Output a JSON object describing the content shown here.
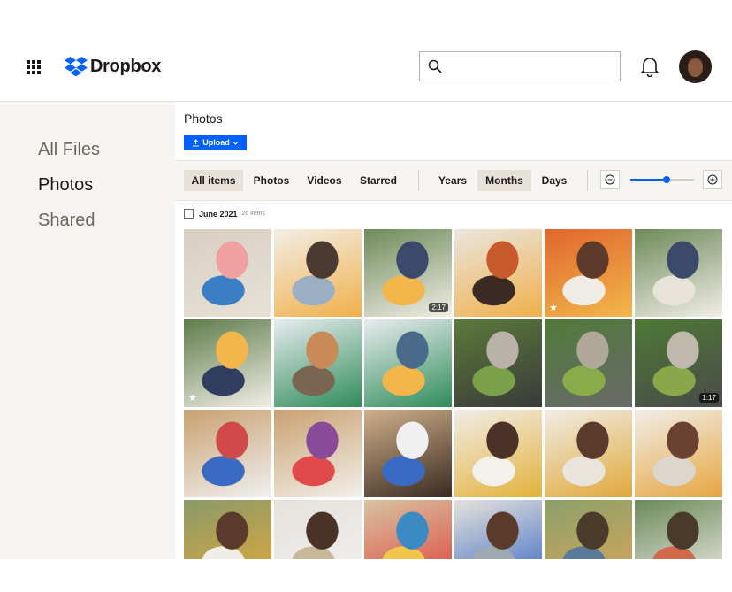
{
  "app": {
    "brand": "Dropbox"
  },
  "search": {
    "placeholder": ""
  },
  "sidebar": {
    "items": [
      {
        "label": "All Files"
      },
      {
        "label": "Photos"
      },
      {
        "label": "Shared"
      }
    ]
  },
  "main": {
    "title": "Photos",
    "upload_label": "Upload"
  },
  "filters": {
    "type_tabs": [
      "All items",
      "Photos",
      "Videos",
      "Starred"
    ],
    "time_tabs": [
      "Years",
      "Months",
      "Days"
    ],
    "selected_type": "All items",
    "selected_time": "Months"
  },
  "zoom": {
    "level": 0.57
  },
  "group": {
    "date": "June 2021",
    "count": "26 items"
  },
  "photos": [
    {
      "colors": [
        "#d7cfc2",
        "#e8e1d6",
        "#f0a0a0",
        "#3a7fc4"
      ],
      "duration": "",
      "starred": false
    },
    {
      "colors": [
        "#f2eee6",
        "#f0b04a",
        "#4a3a30",
        "#9aaec4"
      ],
      "duration": "",
      "starred": false
    },
    {
      "colors": [
        "#6e8a5a",
        "#f1eee6",
        "#3b4a6a",
        "#f2b64a"
      ],
      "duration": "2:17",
      "starred": false
    },
    {
      "colors": [
        "#e9e6df",
        "#f0b04a",
        "#c75a2c",
        "#3b2a24"
      ],
      "duration": "",
      "starred": false
    },
    {
      "colors": [
        "#e0662e",
        "#f2b74a",
        "#5d3a2a",
        "#f0ede6"
      ],
      "duration": "",
      "starred": true
    },
    {
      "colors": [
        "#6e8a5a",
        "#f1eee6",
        "#3b4a6a",
        "#e8e3d9"
      ],
      "duration": "",
      "starred": false
    },
    {
      "colors": [
        "#5e7c4a",
        "#f1eee6",
        "#f2b64a",
        "#2f3d5e"
      ],
      "duration": "",
      "starred": true
    },
    {
      "colors": [
        "#e7ecef",
        "#2f8c5a",
        "#c98a5a",
        "#7a6650"
      ],
      "duration": "",
      "starred": false
    },
    {
      "colors": [
        "#e9ecef",
        "#2f8c5a",
        "#4a6a8c",
        "#f2b64a"
      ],
      "duration": "",
      "starred": false
    },
    {
      "colors": [
        "#5b7a3a",
        "#3a3a3a",
        "#b9b2a8",
        "#7aa04a"
      ],
      "duration": "",
      "starred": false
    },
    {
      "colors": [
        "#4f7a3a",
        "#6a6a6a",
        "#b0a898",
        "#8aab4a"
      ],
      "duration": "",
      "starred": false
    },
    {
      "colors": [
        "#4d7a35",
        "#4a4a4a",
        "#c0b8aa",
        "#88a84a"
      ],
      "duration": "1:17",
      "starred": false
    },
    {
      "colors": [
        "#c9a170",
        "#f0f0f0",
        "#d04a4a",
        "#3a6ac4"
      ],
      "duration": "",
      "starred": false
    },
    {
      "colors": [
        "#c9a170",
        "#f2f0ea",
        "#8a4a9a",
        "#e04a4a"
      ],
      "duration": "",
      "starred": false
    },
    {
      "colors": [
        "#cfb08a",
        "#3a2a22",
        "#f0f0f0",
        "#3a6ac4"
      ],
      "duration": "",
      "starred": false
    },
    {
      "colors": [
        "#f0ede8",
        "#e3b23a",
        "#4a3226",
        "#f4f1ec"
      ],
      "duration": "",
      "starred": false
    },
    {
      "colors": [
        "#f0ede6",
        "#e1a83a",
        "#5a3a2a",
        "#e9e4dc"
      ],
      "duration": "",
      "starred": false
    },
    {
      "colors": [
        "#f1eee8",
        "#e6a640",
        "#6a4232",
        "#dcd6cc"
      ],
      "duration": "",
      "starred": false
    },
    {
      "colors": [
        "#8a9a6a",
        "#e1a93a",
        "#5a3a2a",
        "#f0ece6"
      ],
      "duration": "",
      "starred": false
    },
    {
      "colors": [
        "#e6e2dc",
        "#f0f0f0",
        "#4a3226",
        "#c9b79a"
      ],
      "duration": "",
      "starred": false
    },
    {
      "colors": [
        "#d7c3a2",
        "#e0443a",
        "#3a8ac4",
        "#f2c64a"
      ],
      "duration": "",
      "starred": false
    },
    {
      "colors": [
        "#e6e2dc",
        "#3a6ac4",
        "#5a3a2a",
        "#a0a8b0"
      ],
      "duration": "",
      "starred": false
    },
    {
      "colors": [
        "#8aa06a",
        "#d9a65a",
        "#4a3a2a",
        "#5a7a9a"
      ],
      "duration": "",
      "starred": false
    },
    {
      "colors": [
        "#6a8a5a",
        "#f0ede6",
        "#4a3a2a",
        "#d06a4a"
      ],
      "duration": "",
      "starred": false
    }
  ]
}
